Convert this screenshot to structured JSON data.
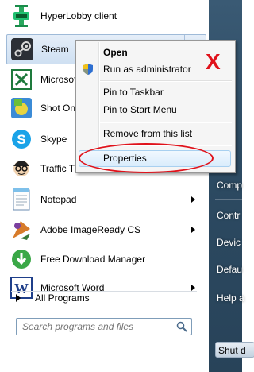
{
  "programs": [
    {
      "label": "HyperLobby client",
      "icon": "hyperlobby-icon",
      "has_submenu": false
    },
    {
      "label": "Steam",
      "icon": "steam-icon",
      "has_submenu": true
    },
    {
      "label": "Microsof",
      "icon": "excel-icon",
      "has_submenu": false
    },
    {
      "label": "Shot Onl",
      "icon": "shot-online-icon",
      "has_submenu": false
    },
    {
      "label": "Skype",
      "icon": "skype-icon",
      "has_submenu": false
    },
    {
      "label": "Traffic Travis",
      "icon": "traffic-travis-icon",
      "has_submenu": false
    },
    {
      "label": "Notepad",
      "icon": "notepad-icon",
      "has_submenu": true
    },
    {
      "label": "Adobe ImageReady CS",
      "icon": "imageready-icon",
      "has_submenu": true
    },
    {
      "label": "Free Download Manager",
      "icon": "fdm-icon",
      "has_submenu": false
    },
    {
      "label": "Microsoft Word",
      "icon": "word-icon",
      "has_submenu": true
    }
  ],
  "all_programs_label": "All Programs",
  "search": {
    "placeholder": "Search programs and files"
  },
  "right_pane": {
    "items": [
      "Comp",
      "Contr",
      "Devic",
      "Defau",
      "Help a"
    ],
    "shutdown_label": "Shut d"
  },
  "context_menu": {
    "open_label": "Open",
    "run_as_admin_label": "Run as administrator",
    "pin_taskbar_label": "Pin to Taskbar",
    "pin_start_label": "Pin to Start Menu",
    "remove_label": "Remove from this list",
    "properties_label": "Properties"
  },
  "annotation": {
    "mark": "X",
    "color": "#e0121b"
  }
}
